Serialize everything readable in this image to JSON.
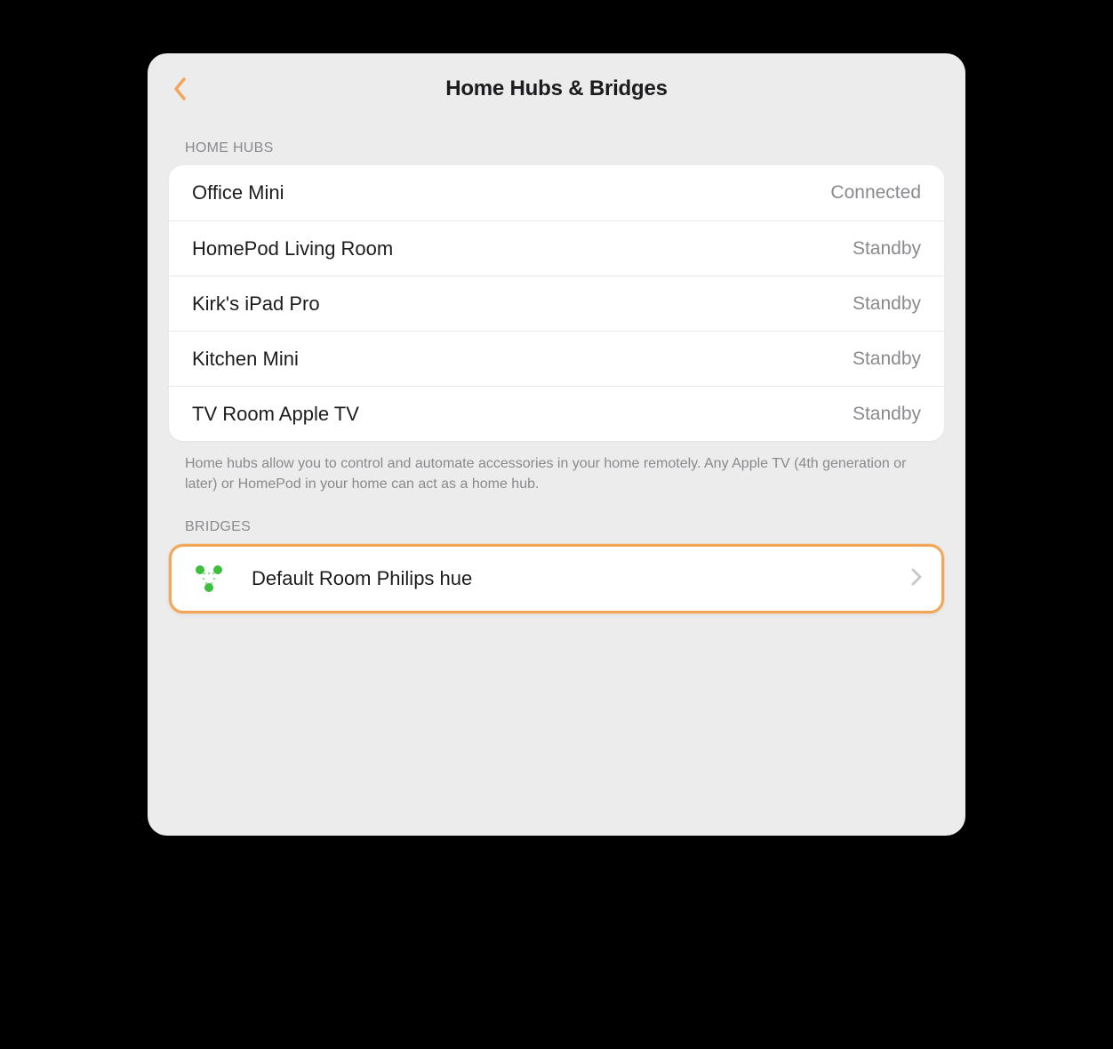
{
  "colors": {
    "accent": "#F2A65A",
    "hue_green": "#3DBE3D",
    "secondary_text": "#8a8a8e"
  },
  "header": {
    "title": "Home Hubs & Bridges"
  },
  "sections": {
    "home_hubs": {
      "header": "HOME HUBS",
      "caption": "Home hubs allow you to control and automate accessories in your home remotely. Any Apple TV (4th generation or later) or HomePod in your home can act as a home hub.",
      "items": [
        {
          "name": "Office Mini",
          "status": "Connected"
        },
        {
          "name": "HomePod Living Room",
          "status": "Standby"
        },
        {
          "name": "Kirk's iPad Pro",
          "status": "Standby"
        },
        {
          "name": "Kitchen Mini",
          "status": "Standby"
        },
        {
          "name": "TV Room Apple TV",
          "status": "Standby"
        }
      ]
    },
    "bridges": {
      "header": "BRIDGES",
      "items": [
        {
          "name": "Default Room Philips hue",
          "icon": "hue-bridge-icon"
        }
      ]
    }
  }
}
